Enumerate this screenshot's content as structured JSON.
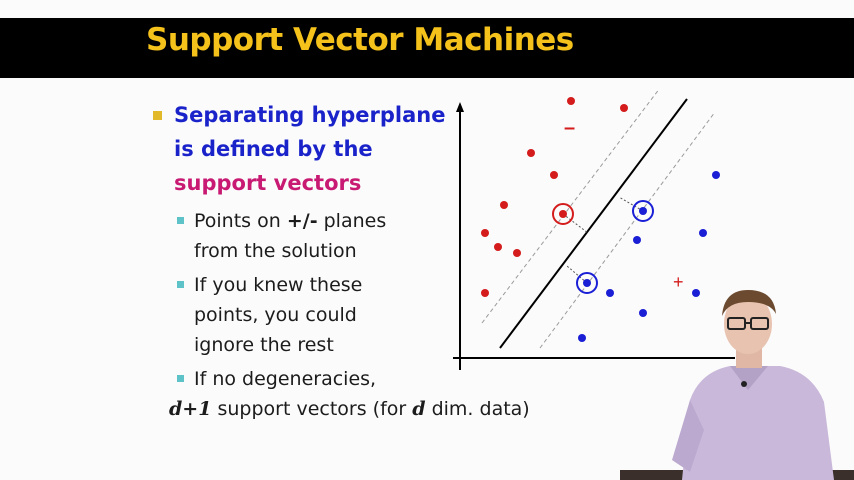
{
  "slide": {
    "title": "Support Vector Machines",
    "bullet_main": {
      "line1": "Separating hyperplane",
      "line2": "is defined by the",
      "line3": "support vectors"
    },
    "sub1": {
      "prefix": "Points on ",
      "bold": "+/-",
      "suffix": " planes",
      "line2": "from the solution"
    },
    "sub2": {
      "line1": "If you knew these",
      "line2": "points, you could",
      "line3": "ignore the rest"
    },
    "sub3": {
      "line1": "If no degeneracies,",
      "var1": "d+1",
      "mid": " support vectors (for ",
      "var2": "d",
      "end": " dim. data)"
    }
  },
  "diagram": {
    "minus_label": "–",
    "plus_label": "+",
    "colors": {
      "negative": "#d41c1c",
      "positive": "#1a1fd6",
      "axis": "#000000",
      "margin": "#9a9a9a"
    }
  }
}
